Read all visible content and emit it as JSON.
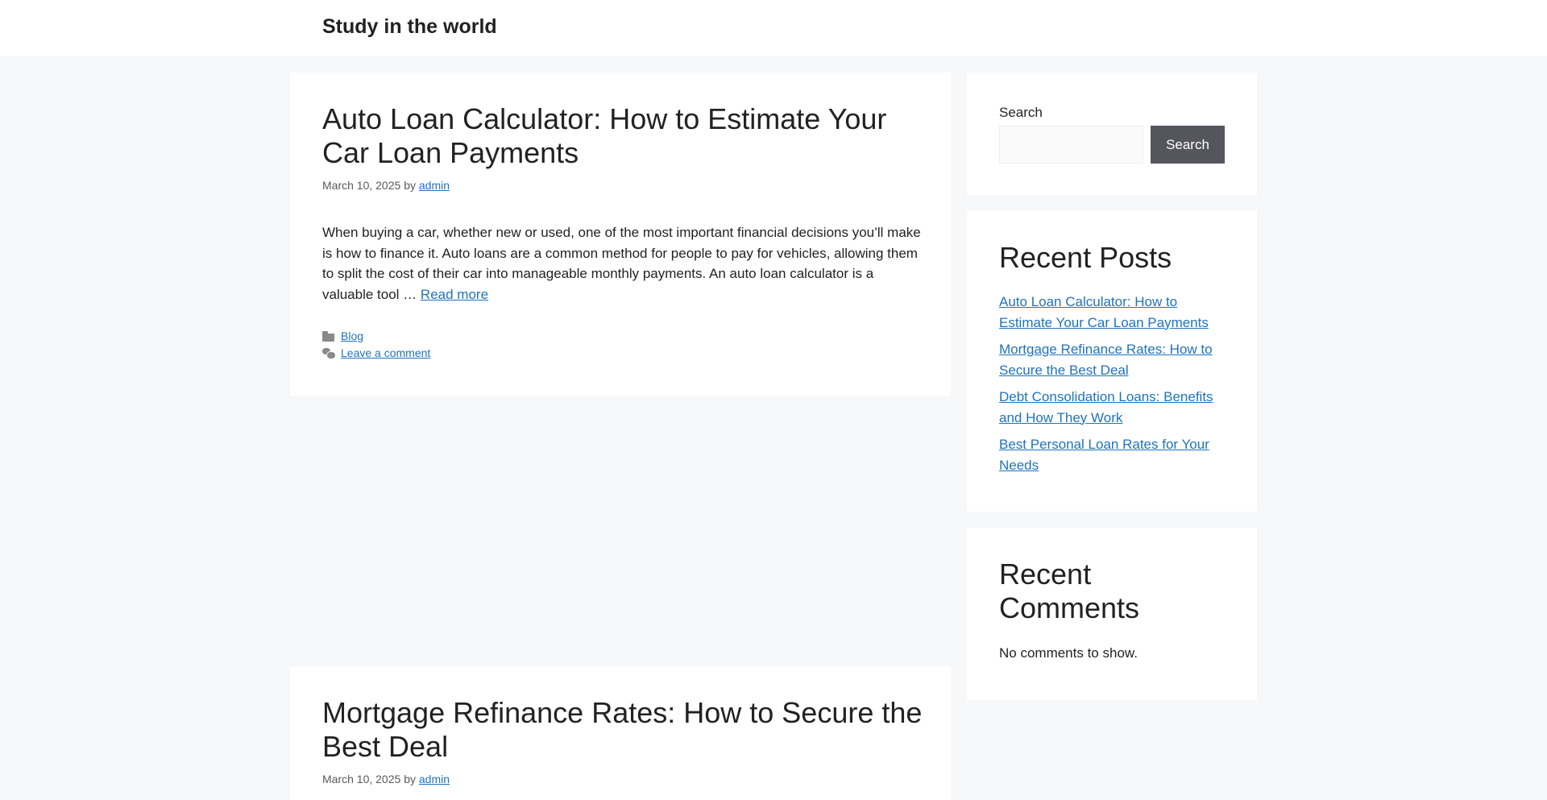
{
  "site": {
    "title": "Study in the world"
  },
  "posts": [
    {
      "title": "Auto Loan Calculator: How to Estimate Your Car Loan Payments",
      "date": "March 10, 2025",
      "by": "by",
      "author": "admin",
      "excerpt": "When buying a car, whether new or used, one of the most important financial decisions you’ll make is how to finance it. Auto loans are a common method for people to pay for vehicles, allowing them to split the cost of their car into manageable monthly payments. An auto loan calculator is a valuable tool …",
      "read_more": "Read more",
      "category": "Blog",
      "comment_link": "Leave a comment"
    },
    {
      "title": "Mortgage Refinance Rates: How to Secure the Best Deal",
      "date": "March 10, 2025",
      "by": "by",
      "author": "admin"
    }
  ],
  "sidebar": {
    "search": {
      "label": "Search",
      "placeholder": "",
      "button": "Search"
    },
    "recent_posts": {
      "heading": "Recent Posts",
      "items": [
        "Auto Loan Calculator: How to Estimate Your Car Loan Payments",
        "Mortgage Refinance Rates: How to Secure the Best Deal",
        "Debt Consolidation Loans: Benefits and How They Work",
        "Best Personal Loan Rates for Your Needs"
      ]
    },
    "recent_comments": {
      "heading": "Recent Comments",
      "empty": "No comments to show."
    }
  },
  "colors": {
    "link": "#1e73be",
    "page_background": "#f7f8f9",
    "search_button": "#55555e"
  },
  "icons": [
    "folder-icon",
    "comment-icon"
  ]
}
